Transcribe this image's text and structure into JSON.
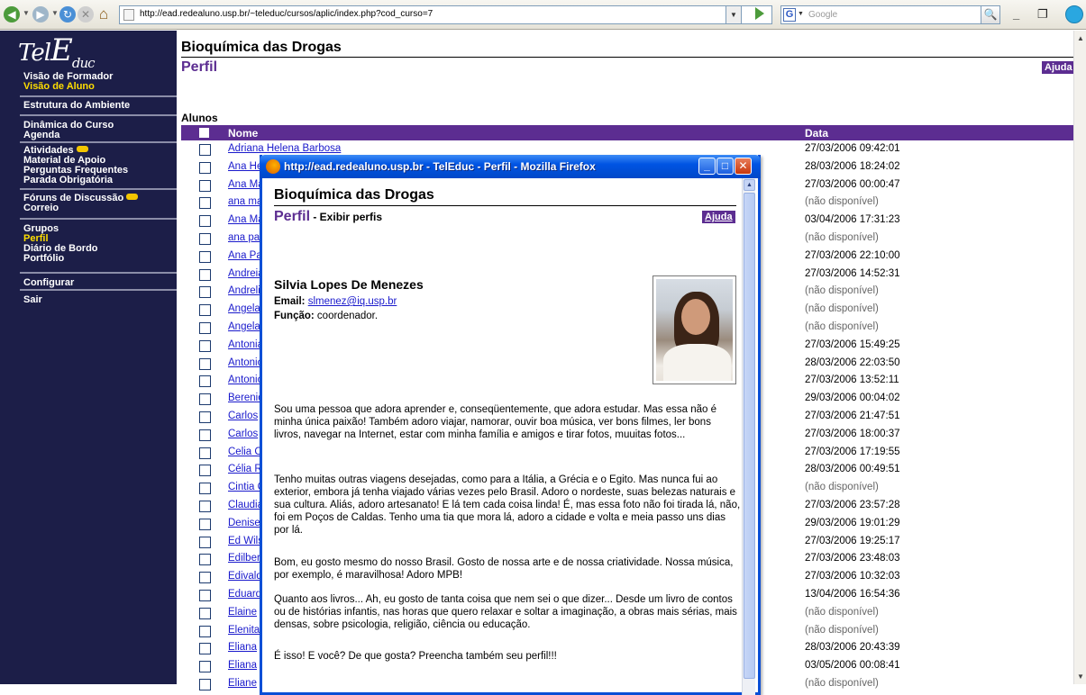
{
  "browser": {
    "url": "http://ead.redealuno.usp.br/~teleduc/cursos/aplic/index.php?cod_curso=7",
    "search_placeholder": "Google",
    "window_controls": "_ ❐ ×"
  },
  "sidebar": {
    "logo_t": "Tel",
    "logo_e": "E",
    "logo_d": "duc",
    "groups": [
      [
        "Visão de Formador",
        "Visão de Aluno"
      ],
      [
        "Estrutura do Ambiente"
      ],
      [
        "Dinâmica do Curso",
        "Agenda"
      ],
      [
        "Atividades",
        "Material de Apoio",
        "Perguntas Frequentes",
        "Parada Obrigatória"
      ],
      [
        "Fóruns de Discussão",
        "Correio"
      ],
      [
        "Grupos",
        "Perfil",
        "Diário de Bordo",
        "Portfólio"
      ],
      [
        "Configurar"
      ],
      [
        "Sair"
      ]
    ],
    "active": [
      "Visão de Aluno",
      "Perfil"
    ]
  },
  "main": {
    "course_title": "Bioquímica das Drogas",
    "page_title": "Perfil",
    "help_label": "Ajuda",
    "section_label": "Alunos",
    "col_name": "Nome",
    "col_date": "Data",
    "rows": [
      {
        "name": "Adriana Helena Barbosa",
        "date": "27/03/2006 09:42:01"
      },
      {
        "name": "Ana He",
        "date": "28/03/2006 18:24:02"
      },
      {
        "name": "Ana Ma",
        "date": "27/03/2006 00:00:47"
      },
      {
        "name": "ana ma",
        "date": "(não disponível)"
      },
      {
        "name": "Ana Ma",
        "date": "03/04/2006 17:31:23"
      },
      {
        "name": "ana pa",
        "date": "(não disponível)"
      },
      {
        "name": "Ana Pa",
        "date": "27/03/2006 22:10:00"
      },
      {
        "name": "Andreia",
        "date": "27/03/2006 14:52:31"
      },
      {
        "name": "Andreli",
        "date": "(não disponível)"
      },
      {
        "name": "Angela",
        "date": "(não disponível)"
      },
      {
        "name": "Angela",
        "date": "(não disponível)"
      },
      {
        "name": "Antonia",
        "date": "27/03/2006 15:49:25"
      },
      {
        "name": "Antonio",
        "date": "28/03/2006 22:03:50"
      },
      {
        "name": "Antonio",
        "date": "27/03/2006 13:52:11"
      },
      {
        "name": "Berenio",
        "date": "29/03/2006 00:04:02"
      },
      {
        "name": "Carlos",
        "date": "27/03/2006 21:47:51"
      },
      {
        "name": "Carlos",
        "date": "27/03/2006 18:00:37"
      },
      {
        "name": "Celia C",
        "date": "27/03/2006 17:19:55"
      },
      {
        "name": "Célia R",
        "date": "28/03/2006 00:49:51"
      },
      {
        "name": "Cintia C",
        "date": "(não disponível)"
      },
      {
        "name": "Claudia",
        "date": "27/03/2006 23:57:28"
      },
      {
        "name": "Denise",
        "date": "29/03/2006 19:01:29"
      },
      {
        "name": "Ed Wils",
        "date": "27/03/2006 19:25:17"
      },
      {
        "name": "Edilber",
        "date": "27/03/2006 23:48:03"
      },
      {
        "name": "Edivald",
        "date": "27/03/2006 10:32:03"
      },
      {
        "name": "Eduard",
        "date": "13/04/2006 16:54:36"
      },
      {
        "name": "Elaine",
        "date": "(não disponível)"
      },
      {
        "name": "Elenita",
        "date": "(não disponível)"
      },
      {
        "name": "Eliana",
        "date": "28/03/2006 20:43:39"
      },
      {
        "name": "Eliana",
        "date": "03/05/2006 00:08:41"
      },
      {
        "name": "Eliane",
        "date": "(não disponível)"
      }
    ]
  },
  "popup": {
    "window_title": "http://ead.redealuno.usp.br - TelEduc - Perfil - Mozilla Firefox",
    "course_title": "Bioquímica das Drogas",
    "title": "Perfil",
    "subtitle": " - Exibir perfis",
    "help_label": "Ajuda",
    "person_name": "Silvia Lopes De Menezes",
    "email_label": "Email: ",
    "email": "slmenez@iq.usp.br",
    "role_label": "Função: ",
    "role": "coordenador.",
    "paragraphs": [
      "Sou uma pessoa que adora aprender e, conseqüentemente, que adora estudar. Mas essa não é minha única paixão! Também adoro viajar, namorar, ouvir boa música, ver bons filmes, ler bons livros, navegar na Internet, estar com minha família e amigos e tirar fotos, muuitas fotos...",
      "Tenho muitas outras viagens desejadas, como para a Itália, a Grécia e o Egito. Mas nunca fui ao exterior, embora já tenha viajado várias vezes pelo Brasil. Adoro o nordeste, suas belezas naturais e sua cultura. Aliás, adoro artesanato! E lá tem cada coisa linda! É, mas essa foto não foi tirada lá, não, foi em Poços de Caldas. Tenho uma tia que mora lá, adoro a cidade e volta e meia passo uns dias por lá.",
      "Bom, eu gosto mesmo do nosso Brasil. Gosto de nossa arte e de nossa criatividade. Nossa música, por exemplo, é maravilhosa! Adoro MPB!",
      "Quanto aos livros... Ah, eu gosto de tanta coisa que nem sei o que dizer... Desde um livro de contos ou de histórias infantis, nas horas que quero relaxar e soltar a imaginação, a obras mais sérias, mais densas, sobre psicologia, religião, ciência ou educação.",
      "É isso! E você? De que gosta? Preencha também seu perfil!!!"
    ]
  },
  "colors": {
    "sidebar_bg": "#1c1e48",
    "accent_purple": "#5c2d91",
    "active_nav": "#ffde00",
    "link": "#1a1acc",
    "xp_blue": "#0054e3"
  }
}
